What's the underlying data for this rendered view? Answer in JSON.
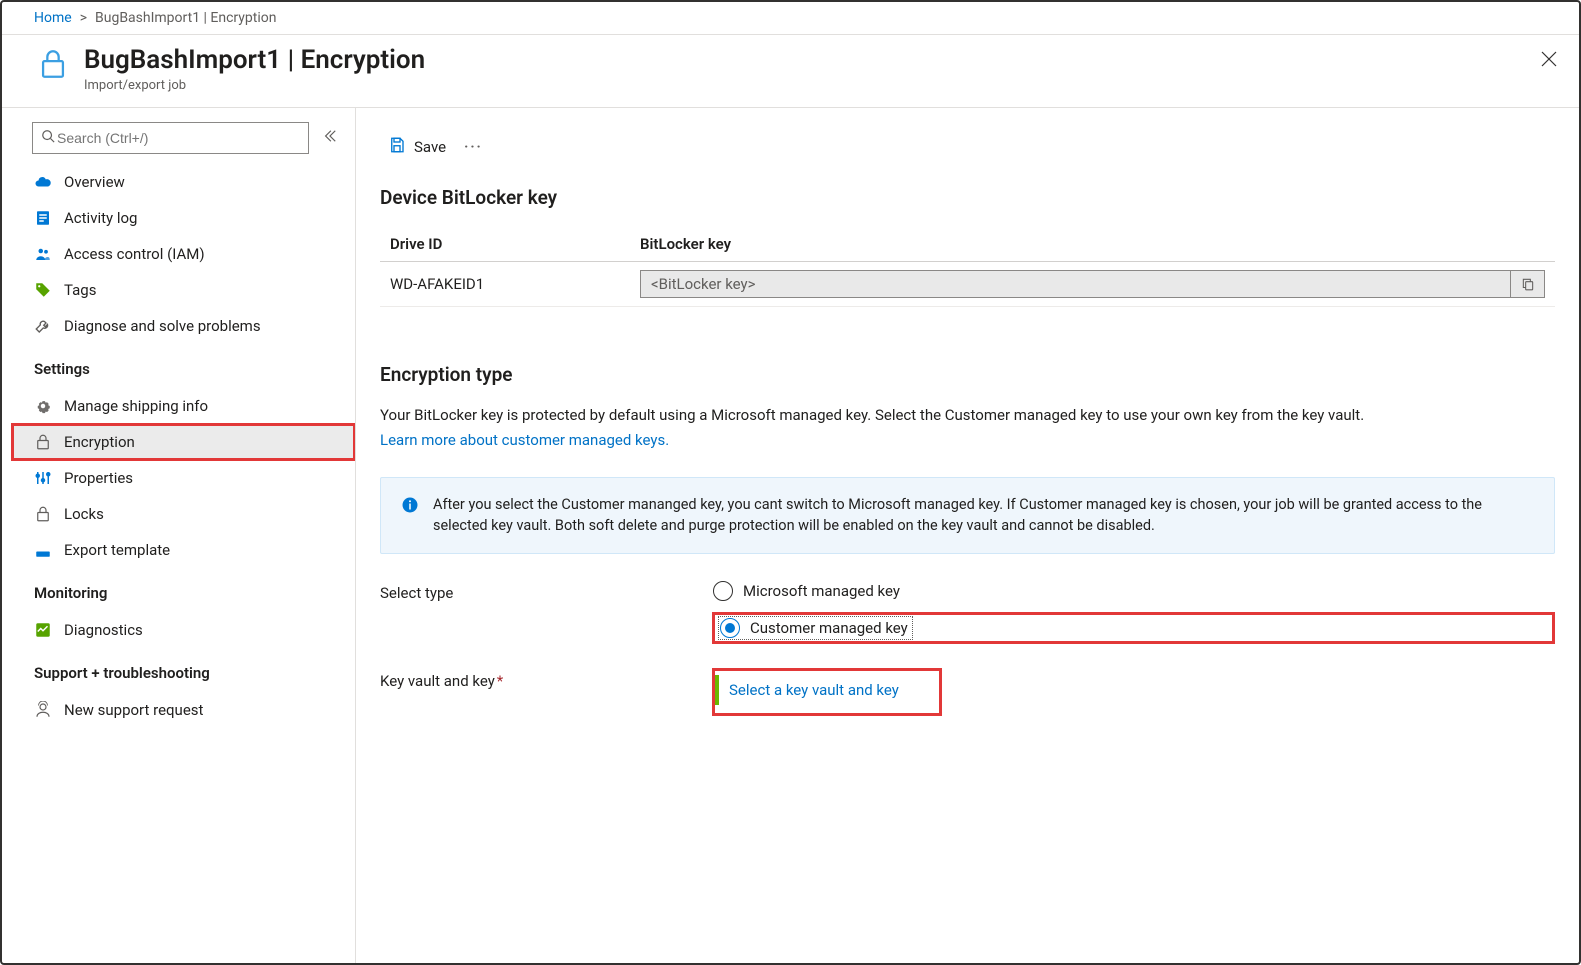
{
  "breadcrumb": {
    "home": "Home",
    "current": "BugBashImport1 | Encryption"
  },
  "header": {
    "title": "BugBashImport1 | Encryption",
    "subtitle": "Import/export job"
  },
  "search": {
    "placeholder": "Search (Ctrl+/)"
  },
  "sidebar": {
    "items_top": [
      {
        "label": "Overview",
        "icon": "cloud"
      },
      {
        "label": "Activity log",
        "icon": "log"
      },
      {
        "label": "Access control (IAM)",
        "icon": "people"
      },
      {
        "label": "Tags",
        "icon": "tag"
      },
      {
        "label": "Diagnose and solve problems",
        "icon": "wrench"
      }
    ],
    "section_settings": "Settings",
    "items_settings": [
      {
        "label": "Manage shipping info",
        "icon": "gear"
      },
      {
        "label": "Encryption",
        "icon": "lock",
        "selected": true,
        "highlighted": true
      },
      {
        "label": "Properties",
        "icon": "sliders"
      },
      {
        "label": "Locks",
        "icon": "lock2"
      },
      {
        "label": "Export template",
        "icon": "export"
      }
    ],
    "section_monitoring": "Monitoring",
    "items_monitoring": [
      {
        "label": "Diagnostics",
        "icon": "diag"
      }
    ],
    "section_support": "Support + troubleshooting",
    "items_support": [
      {
        "label": "New support request",
        "icon": "support"
      }
    ]
  },
  "toolbar": {
    "save": "Save"
  },
  "bitlocker": {
    "title": "Device BitLocker key",
    "col_drive": "Drive ID",
    "col_key": "BitLocker key",
    "rows": [
      {
        "drive_id": "WD-AFAKEID1",
        "key_placeholder": "<BitLocker key>"
      }
    ]
  },
  "encryption": {
    "title": "Encryption type",
    "para": "Your BitLocker key is protected by default using a Microsoft managed key. Select the Customer managed key to use your own key from the key vault.",
    "link": "Learn more about customer managed keys.",
    "info": "After you select the Customer mananged key, you cant switch to Microsoft managed key. If Customer managed key is chosen, your job will be granted access to the selected key vault. Both soft delete and purge protection will be enabled on the key vault and cannot be disabled.",
    "select_type_label": "Select type",
    "opt_ms": "Microsoft managed key",
    "opt_cust": "Customer managed key",
    "kv_label": "Key vault and key",
    "kv_link": "Select a key vault and key"
  }
}
